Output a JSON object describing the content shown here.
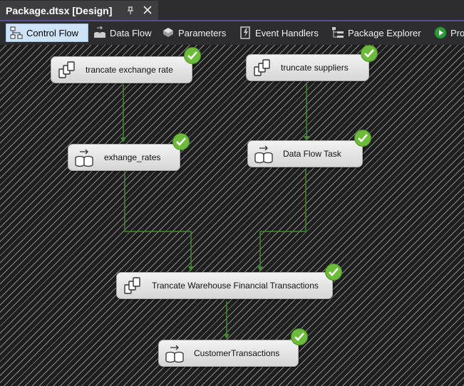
{
  "document_tab": {
    "title": "Package.dtsx [Design]"
  },
  "designer_tabs": [
    {
      "label": "Control Flow",
      "icon": "control-flow-icon",
      "active": true
    },
    {
      "label": "Data Flow",
      "icon": "data-flow-icon"
    },
    {
      "label": "Parameters",
      "icon": "parameters-icon"
    },
    {
      "label": "Event Handlers",
      "icon": "event-handlers-icon"
    },
    {
      "label": "Package Explorer",
      "icon": "package-explorer-icon"
    },
    {
      "label": "Pro",
      "icon": "progress-icon"
    }
  ],
  "tasks": [
    {
      "label": "trancate exchange rate",
      "type": "execute-sql",
      "status": "success"
    },
    {
      "label": "truncate suppliers",
      "type": "execute-sql",
      "status": "success"
    },
    {
      "label": "exhange_rates",
      "type": "data-flow",
      "status": "success"
    },
    {
      "label": "Data Flow Task",
      "type": "data-flow",
      "status": "success"
    },
    {
      "label": "Trancate Warehouse Financial Transactions",
      "type": "execute-sql",
      "status": "success"
    },
    {
      "label": "CustomerTransactions",
      "type": "data-flow",
      "status": "success"
    }
  ],
  "colors": {
    "success": "#6dbb3a",
    "connector": "#3c8c2a",
    "active_tab": "#cde3f7",
    "accent": "#5b4a9e"
  }
}
